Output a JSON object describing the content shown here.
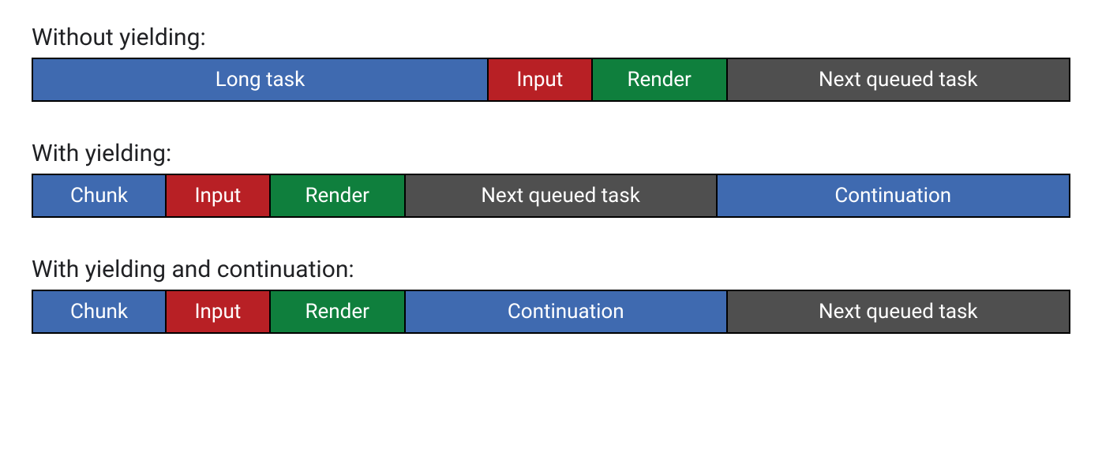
{
  "sections": [
    {
      "title": "Without yielding:",
      "segments": [
        {
          "label": "Long task",
          "color": "blue",
          "flex": 44
        },
        {
          "label": "Input",
          "color": "red",
          "flex": 10
        },
        {
          "label": "Render",
          "color": "green",
          "flex": 13
        },
        {
          "label": "Next queued task",
          "color": "gray",
          "flex": 33
        }
      ]
    },
    {
      "title": "With yielding:",
      "segments": [
        {
          "label": "Chunk",
          "color": "blue",
          "flex": 13
        },
        {
          "label": "Input",
          "color": "red",
          "flex": 10
        },
        {
          "label": "Render",
          "color": "green",
          "flex": 13
        },
        {
          "label": "Next queued task",
          "color": "gray",
          "flex": 30
        },
        {
          "label": "Continuation",
          "color": "blue",
          "flex": 34
        }
      ]
    },
    {
      "title": "With yielding and continuation:",
      "segments": [
        {
          "label": "Chunk",
          "color": "blue",
          "flex": 13
        },
        {
          "label": "Input",
          "color": "red",
          "flex": 10
        },
        {
          "label": "Render",
          "color": "green",
          "flex": 13
        },
        {
          "label": "Continuation",
          "color": "blue",
          "flex": 31
        },
        {
          "label": "Next queued task",
          "color": "gray",
          "flex": 33
        }
      ]
    }
  ]
}
